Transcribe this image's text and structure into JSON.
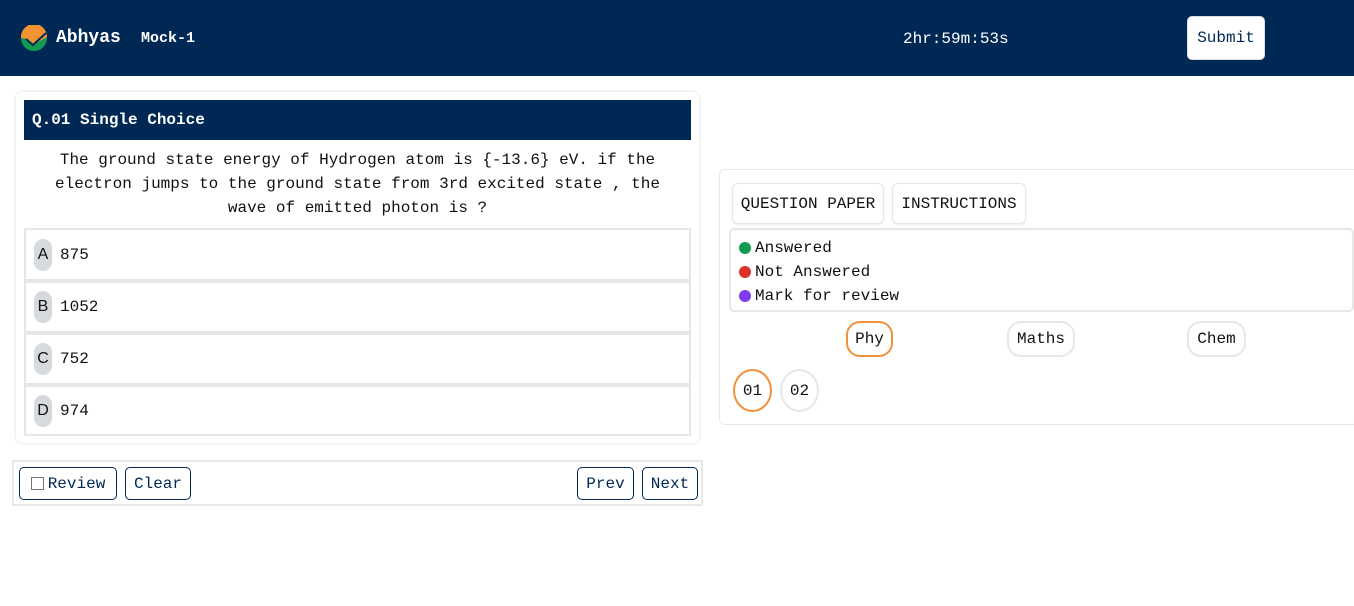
{
  "header": {
    "brand": "Abhyas",
    "test_name": "Mock-1",
    "timer": "2hr:59m:53s",
    "submit_label": "Submit",
    "logo_icon": "abhyas-check-logo",
    "colors": {
      "background": "#002855",
      "logo_orange": "#f39433",
      "logo_green": "#139a52"
    }
  },
  "question": {
    "header": "Q.01 Single Choice",
    "text": "The ground state energy of Hydrogen atom is {-13.6} eV. if the electron jumps to the ground state from 3rd excited state , the wave of emitted photon is ?",
    "options": [
      {
        "letter": "A",
        "value": "875"
      },
      {
        "letter": "B",
        "value": "1052"
      },
      {
        "letter": "C",
        "value": "752"
      },
      {
        "letter": "D",
        "value": "974"
      }
    ]
  },
  "actions": {
    "review_label": "Review",
    "review_checked": false,
    "clear_label": "Clear",
    "prev_label": "Prev",
    "next_label": "Next"
  },
  "sidebar": {
    "tabs": [
      {
        "label": "QUESTION PAPER"
      },
      {
        "label": "INSTRUCTIONS"
      }
    ],
    "legend": [
      {
        "label": "Answered",
        "color": "#139a52"
      },
      {
        "label": "Not Answered",
        "color": "#e0302a"
      },
      {
        "label": "Mark for review",
        "color": "#7d3cf0"
      }
    ],
    "subjects": [
      {
        "label": "Phy",
        "active": true
      },
      {
        "label": "Maths",
        "active": false
      },
      {
        "label": "Chem",
        "active": false
      }
    ],
    "questions": [
      {
        "label": "01",
        "active": true
      },
      {
        "label": "02",
        "active": false
      }
    ],
    "active_color": "#f0923a"
  }
}
